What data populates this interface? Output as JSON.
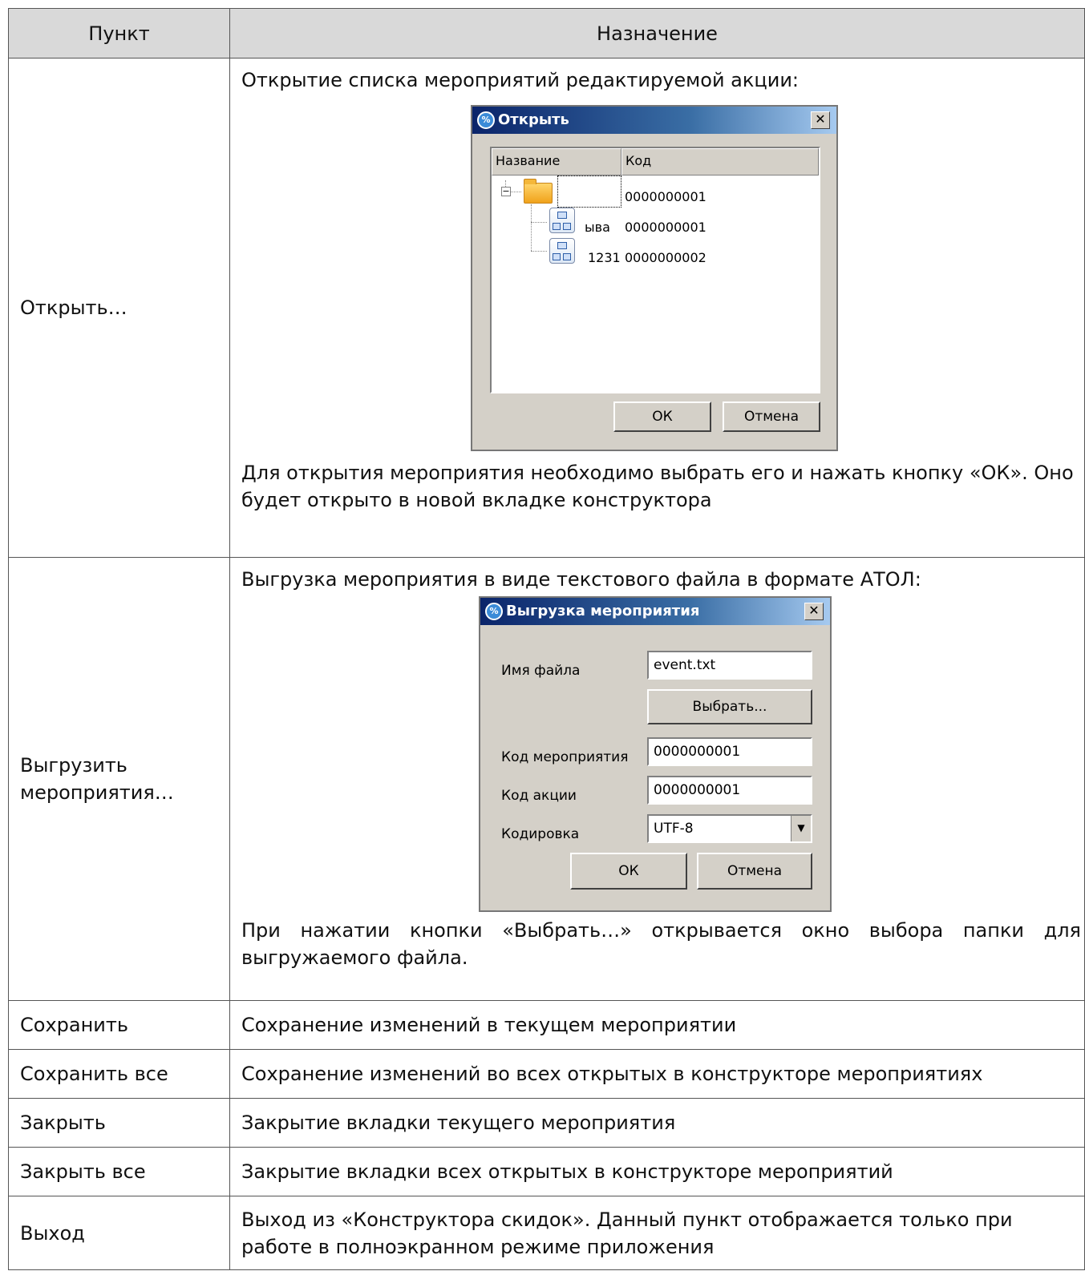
{
  "table": {
    "headers": [
      "Пункт",
      "Назначение"
    ],
    "rows": [
      {
        "item": "Открыть…",
        "intro": "Открытие списка мероприятий редактируемой акции:",
        "outro": "Для открытия мероприятия необходимо выбрать его и нажать кнопку «ОК». Оно будет открыто в новой вкладке конструктора"
      },
      {
        "item": "Выгрузить мероприятия…",
        "intro": "Выгрузка мероприятия в виде текстового файла в формате АТОЛ:",
        "outro": "При нажатии кнопки «Выбрать…» открывается окно выбора папки для выгружаемого файла."
      },
      {
        "item": "Сохранить",
        "desc": "Сохранение изменений в текущем мероприятии"
      },
      {
        "item": "Сохранить все",
        "desc": "Сохранение изменений во всех открытых в конструкторе мероприятиях"
      },
      {
        "item": "Закрыть",
        "desc": "Закрытие вкладки текущего мероприятия"
      },
      {
        "item": "Закрыть все",
        "desc": "Закрытие вкладки всех открытых в конструкторе мероприятий"
      },
      {
        "item": "Выход",
        "desc": "Выход из «Конструктора скидок». Данный пункт отображается только при работе в полноэкранном режиме приложения"
      }
    ]
  },
  "open_dialog": {
    "title": "Открыть",
    "close_glyph": "✕",
    "columns": [
      "Название",
      "Код"
    ],
    "tree": [
      {
        "name": "",
        "code": "0000000001",
        "icon": "folder-icon"
      },
      {
        "name": "ыва",
        "code": "0000000001",
        "icon": "event-icon"
      },
      {
        "name": "1231",
        "code": "0000000002",
        "icon": "event-icon"
      }
    ],
    "ok": "ОК",
    "cancel": "Отмена"
  },
  "export_dialog": {
    "title": "Выгрузка мероприятия",
    "close_glyph": "✕",
    "file_label": "Имя файла",
    "file_value": "event.txt",
    "choose": "Выбрать...",
    "event_code_label": "Код мероприятия",
    "event_code_value": "0000000001",
    "promo_code_label": "Код акции",
    "promo_code_value": "0000000001",
    "encoding_label": "Кодировка",
    "encoding_value": "UTF-8",
    "ok": "ОК",
    "cancel": "Отмена"
  }
}
